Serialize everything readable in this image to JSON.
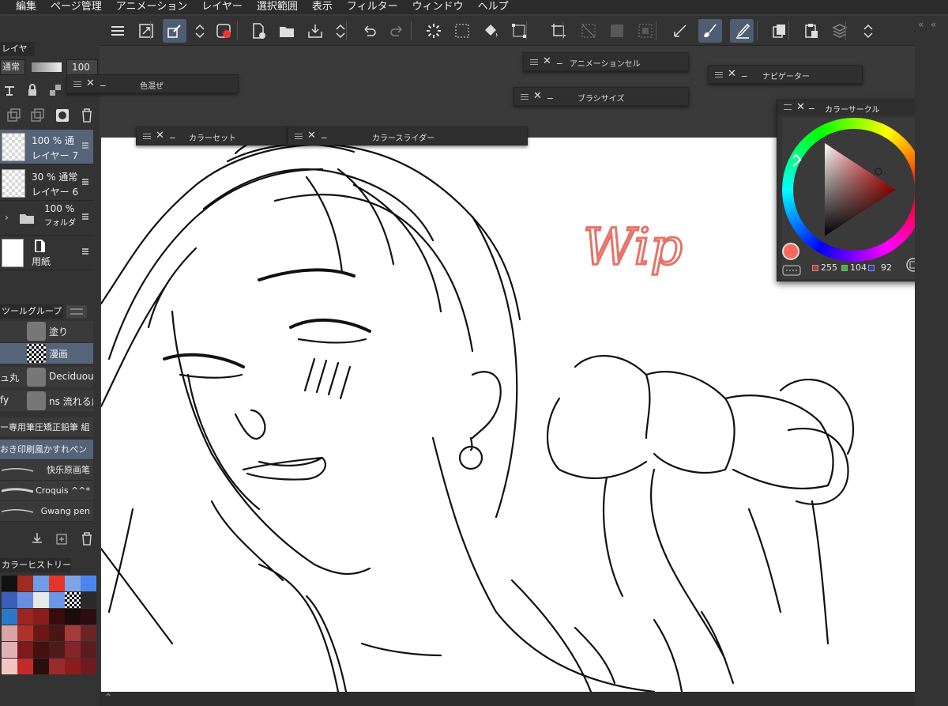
{
  "menu": [
    "編集",
    "ページ管理",
    "アニメーション",
    "レイヤー",
    "選択範囲",
    "表示",
    "フィルター",
    "ウィンドウ",
    "ヘルプ"
  ],
  "toolbar": {
    "icons": [
      "menu-icon",
      "fit-icon",
      "transform-icon",
      "updown-icon",
      "record-icon",
      "new-icon",
      "open-icon",
      "save-icon",
      "updown2-icon",
      "undo-icon",
      "redo-icon",
      "loading-icon",
      "select-icon",
      "fill-icon",
      "transform2-icon",
      "crop-icon",
      "grid1-icon",
      "grid2-icon",
      "grid3-icon",
      "ruler-icon",
      "brush-icon",
      "pen-icon",
      "copy-icon",
      "paste-icon",
      "layers-icon",
      "updown3-icon"
    ]
  },
  "layer_panel": {
    "title": "レイヤー",
    "blend": "通常",
    "opacity": "100",
    "layers": [
      {
        "line1": "100 %  通",
        "line2": "レイヤー 7",
        "selected": true
      },
      {
        "line1": "30 %  通常",
        "line2": "レイヤー 6",
        "selected": false
      },
      {
        "line1": "100 %",
        "line2": "フォルダ",
        "selected": false
      },
      {
        "line1": "",
        "line2": "用紙",
        "selected": false
      }
    ]
  },
  "tool_group": {
    "title": "ツールグループ",
    "items": [
      {
        "label": "塗り"
      },
      {
        "label": "漫画"
      },
      {
        "left": "ュ丸",
        "label": "Deciduous"
      },
      {
        "left": "fy",
        "label": "ns 流れる血"
      }
    ]
  },
  "brushes": [
    "ー専用筆圧矯正鉛筆 組",
    "おき印刷風かすれペン",
    "快乐原画笔",
    "Croquis ^^*",
    "Gwang pen"
  ],
  "color_history": {
    "title": "カラーヒストリー"
  },
  "palettes": {
    "color_mix": "色混ぜ",
    "color_set": "カラーセット",
    "color_slider": "カラースライダー",
    "animation_cell": "アニメーションセル",
    "brush_size": "ブラシサイズ",
    "navigator": "ナビゲーター",
    "color_circle": "カラーサークル"
  },
  "color": {
    "r": "255",
    "g": "104",
    "b": "92",
    "hex": "#ff685c"
  },
  "canvas_text": "Wip"
}
